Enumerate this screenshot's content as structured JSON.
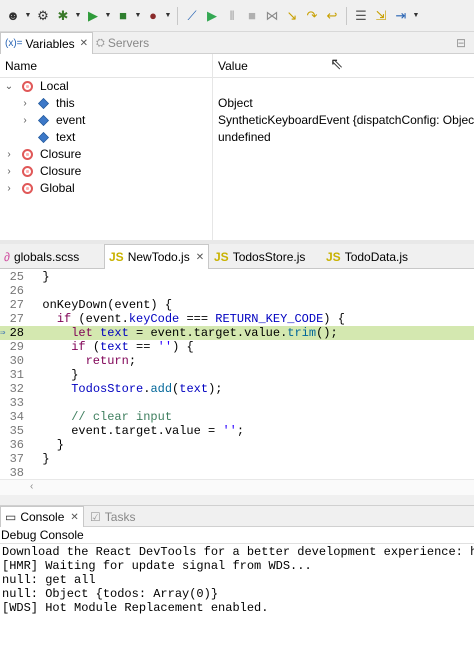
{
  "toolbar": {
    "items": [
      {
        "icon": "debug-user-icon",
        "glyph": "☻",
        "color": "#333333",
        "dropdown": true
      },
      {
        "icon": "settings-gear-icon",
        "glyph": "⚙",
        "color": "#333333",
        "dropdown": false
      },
      {
        "icon": "debug-bug-icon",
        "glyph": "✱",
        "color": "#3a7a2a",
        "dropdown": true
      },
      {
        "icon": "run-icon",
        "glyph": "▶",
        "color": "#2f9b3a",
        "dropdown": true
      },
      {
        "icon": "run-external-icon",
        "glyph": "■",
        "color": "#2f7f2f",
        "dropdown": true
      },
      {
        "icon": "external-tools-icon",
        "glyph": "●",
        "color": "#8a2a2a",
        "dropdown": true
      },
      {
        "icon": "skip-breakpoints-icon",
        "glyph": "⟋",
        "color": "#2864b4",
        "dropdown": false
      },
      {
        "icon": "resume-icon",
        "glyph": "▶",
        "color": "#34a853",
        "dropdown": false
      },
      {
        "icon": "suspend-icon",
        "glyph": "‖",
        "color": "#a0a0a0",
        "dropdown": false
      },
      {
        "icon": "terminate-icon",
        "glyph": "■",
        "color": "#b0b0b0",
        "dropdown": false
      },
      {
        "icon": "disconnect-icon",
        "glyph": "⋈",
        "color": "#8a8a8a",
        "dropdown": false
      },
      {
        "icon": "step-into-icon",
        "glyph": "↘",
        "color": "#c8a000",
        "dropdown": false
      },
      {
        "icon": "step-over-icon",
        "glyph": "↷",
        "color": "#c8a000",
        "dropdown": false
      },
      {
        "icon": "step-return-icon",
        "glyph": "↩",
        "color": "#c8a000",
        "dropdown": false
      },
      {
        "icon": "use-step-filters-icon",
        "glyph": "☰",
        "color": "#555555",
        "dropdown": false
      },
      {
        "icon": "drop-to-frame-icon",
        "glyph": "⇲",
        "color": "#c8a000",
        "dropdown": false
      },
      {
        "icon": "next-annotation-icon",
        "glyph": "⇥",
        "color": "#2864b4",
        "dropdown": true
      }
    ]
  },
  "views": {
    "tabs": [
      {
        "label": "Variables",
        "active": true
      },
      {
        "label": "Servers",
        "active": false
      }
    ]
  },
  "variables": {
    "columns": [
      "Name",
      "Value"
    ],
    "rows": [
      {
        "indent": 0,
        "twisty": "⌄",
        "kind": "scope",
        "name": "Local",
        "value": ""
      },
      {
        "indent": 1,
        "twisty": "›",
        "kind": "field",
        "name": "this",
        "value": "Object"
      },
      {
        "indent": 1,
        "twisty": "›",
        "kind": "field",
        "name": "event",
        "value": "SyntheticKeyboardEvent {dispatchConfig: Object, di"
      },
      {
        "indent": 1,
        "twisty": "",
        "kind": "field",
        "name": "text",
        "value": "undefined"
      },
      {
        "indent": 0,
        "twisty": "›",
        "kind": "scope",
        "name": "Closure",
        "value": ""
      },
      {
        "indent": 0,
        "twisty": "›",
        "kind": "scope",
        "name": "Closure",
        "value": ""
      },
      {
        "indent": 0,
        "twisty": "›",
        "kind": "scope",
        "name": "Global",
        "value": ""
      }
    ]
  },
  "editor": {
    "tabs": [
      {
        "label": "globals.scss",
        "type": "css",
        "active": false,
        "closable": false
      },
      {
        "label": "NewTodo.js",
        "type": "js",
        "active": true,
        "closable": true
      },
      {
        "label": "TodosStore.js",
        "type": "js",
        "active": false,
        "closable": false
      },
      {
        "label": "TodoData.js",
        "type": "js",
        "active": false,
        "closable": false
      }
    ],
    "current_line": "28",
    "lines": [
      {
        "num": "25",
        "tokens": [
          {
            "t": "  }",
            "c": ""
          }
        ]
      },
      {
        "num": "26",
        "tokens": [
          {
            "t": "",
            "c": ""
          }
        ]
      },
      {
        "num": "27",
        "tokens": [
          {
            "t": "  onKeyDown(event) {",
            "c": ""
          }
        ]
      },
      {
        "num": "27",
        "tokens": [
          {
            "t": "    ",
            "c": ""
          },
          {
            "t": "if",
            "c": "kw"
          },
          {
            "t": " (event.",
            "c": ""
          },
          {
            "t": "keyCode",
            "c": "cn"
          },
          {
            "t": " === ",
            "c": ""
          },
          {
            "t": "RETURN_KEY_CODE",
            "c": "cn"
          },
          {
            "t": ") {",
            "c": ""
          }
        ]
      },
      {
        "num": "28",
        "tokens": [
          {
            "t": "      ",
            "c": ""
          },
          {
            "t": "let",
            "c": "kw"
          },
          {
            "t": " ",
            "c": ""
          },
          {
            "t": "text",
            "c": "cn"
          },
          {
            "t": " = event.target.value.",
            "c": ""
          },
          {
            "t": "trim",
            "c": "mm"
          },
          {
            "t": "();",
            "c": ""
          }
        ]
      },
      {
        "num": "29",
        "tokens": [
          {
            "t": "      ",
            "c": ""
          },
          {
            "t": "if",
            "c": "kw"
          },
          {
            "t": " (",
            "c": ""
          },
          {
            "t": "text",
            "c": "cn"
          },
          {
            "t": " == ",
            "c": ""
          },
          {
            "t": "''",
            "c": "st"
          },
          {
            "t": ") {",
            "c": ""
          }
        ]
      },
      {
        "num": "30",
        "tokens": [
          {
            "t": "        ",
            "c": ""
          },
          {
            "t": "return",
            "c": "kw"
          },
          {
            "t": ";",
            "c": ""
          }
        ]
      },
      {
        "num": "31",
        "tokens": [
          {
            "t": "      }",
            "c": ""
          }
        ]
      },
      {
        "num": "32",
        "tokens": [
          {
            "t": "      ",
            "c": ""
          },
          {
            "t": "TodosStore",
            "c": "cn"
          },
          {
            "t": ".",
            "c": ""
          },
          {
            "t": "add",
            "c": "mm"
          },
          {
            "t": "(",
            "c": ""
          },
          {
            "t": "text",
            "c": "cn"
          },
          {
            "t": ");",
            "c": ""
          }
        ]
      },
      {
        "num": "33",
        "tokens": [
          {
            "t": "",
            "c": ""
          }
        ]
      },
      {
        "num": "34",
        "tokens": [
          {
            "t": "      ",
            "c": ""
          },
          {
            "t": "// clear input",
            "c": "cm"
          }
        ]
      },
      {
        "num": "35",
        "tokens": [
          {
            "t": "      event.target.value = ",
            "c": ""
          },
          {
            "t": "''",
            "c": "st"
          },
          {
            "t": ";",
            "c": ""
          }
        ]
      },
      {
        "num": "36",
        "tokens": [
          {
            "t": "    }",
            "c": ""
          }
        ]
      },
      {
        "num": "37",
        "tokens": [
          {
            "t": "  }",
            "c": ""
          }
        ]
      },
      {
        "num": "38",
        "tokens": [
          {
            "t": "",
            "c": ""
          }
        ]
      }
    ]
  },
  "console": {
    "tabs": [
      {
        "label": "Console",
        "active": true,
        "closable": true
      },
      {
        "label": "Tasks",
        "active": false,
        "closable": false
      }
    ],
    "title": "Debug Console",
    "lines": [
      "Download the React DevTools for a better development experience: https:/",
      "[HMR] Waiting for update signal from WDS...",
      "null: get all",
      "null: Object {todos: Array(0)}",
      "[WDS] Hot Module Replacement enabled."
    ]
  }
}
